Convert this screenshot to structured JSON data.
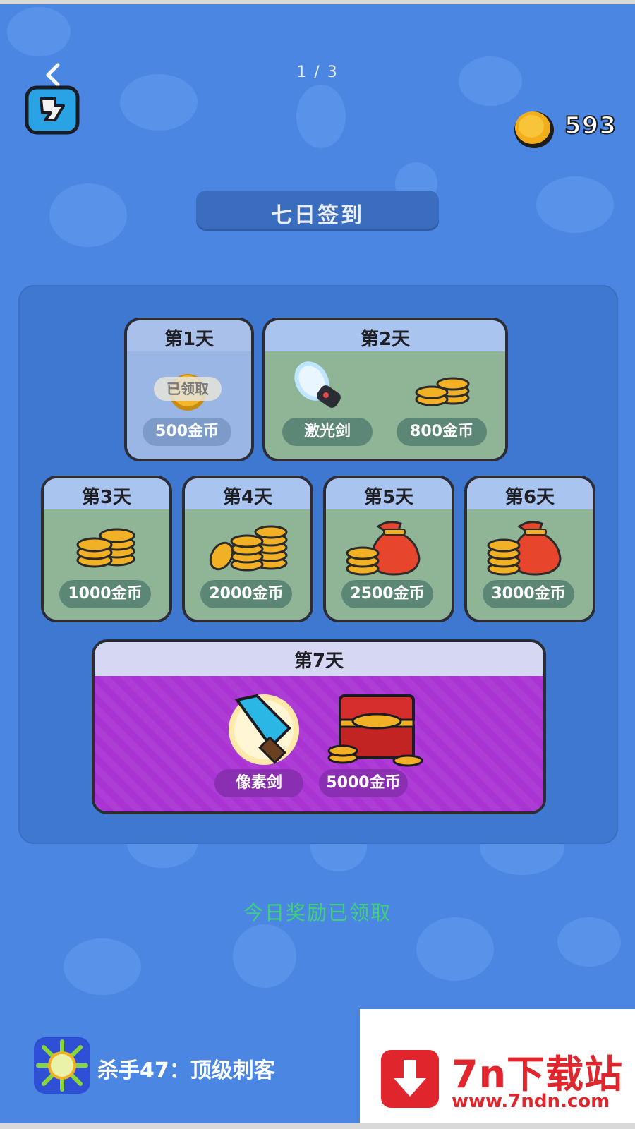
{
  "header": {
    "page_indicator": "1 / 3",
    "coins": "593"
  },
  "title": "七日签到",
  "days": [
    {
      "label": "第1天",
      "rewards": [
        {
          "icon": "gold-coin-icon",
          "text": "500金币"
        }
      ],
      "badge": "已领取"
    },
    {
      "label": "第2天",
      "rewards": [
        {
          "icon": "laser-sword-icon",
          "text": "激光剑"
        },
        {
          "icon": "coin-stack-icon",
          "text": "800金币"
        }
      ]
    },
    {
      "label": "第3天",
      "rewards": [
        {
          "icon": "coin-stack-icon",
          "text": "1000金币"
        }
      ]
    },
    {
      "label": "第4天",
      "rewards": [
        {
          "icon": "coin-pile-icon",
          "text": "2000金币"
        }
      ]
    },
    {
      "label": "第5天",
      "rewards": [
        {
          "icon": "coin-bag-icon",
          "text": "2500金币"
        }
      ]
    },
    {
      "label": "第6天",
      "rewards": [
        {
          "icon": "coin-bag-icon",
          "text": "3000金币"
        }
      ]
    },
    {
      "label": "第7天",
      "rewards": [
        {
          "icon": "pixel-sword-icon",
          "text": "像素剑"
        },
        {
          "icon": "treasure-chest-icon",
          "text": "5000金币"
        }
      ]
    }
  ],
  "status": "今日奖励已领取",
  "footer": {
    "app_name": "杀手47：顶级刺客",
    "watermark_title": "7n下载站",
    "watermark_url": "www.7ndn.com"
  },
  "colors": {
    "background": "#4b87e2",
    "panel": "#3f78d0",
    "status_green": "#3fd17a",
    "day7_purple": "#a933d3",
    "watermark_red": "#e0262c"
  }
}
